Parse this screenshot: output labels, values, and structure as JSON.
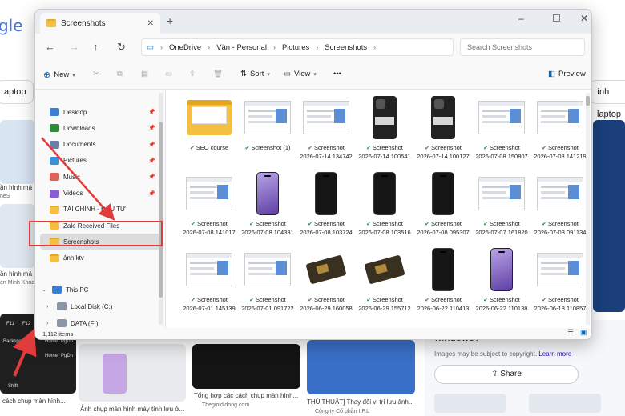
{
  "background": {
    "logo": "gle",
    "chips": [
      "aptop",
      "ính laptop"
    ],
    "left_snippets": [
      "ần hình má",
      "neS",
      "ần hình má",
      "en Minh Khoa"
    ],
    "captions": [
      {
        "text": "cách chụp màn hình...",
        "src": ""
      },
      {
        "text": "Ảnh chụp màn hình máy tính lưu ở...",
        "src": ""
      },
      {
        "text": "Tổng hợp các cách chụp màn hình...",
        "src": "Thegioididong.com"
      },
      {
        "text": "THỦ THUẬT] Thay đổi vị trí lưu ảnh...",
        "src": "Công ty Cổ phần I.P.L"
      }
    ],
    "panel_heading": "windows?",
    "panel_note": "Images may be subject to copyright.",
    "panel_learn": "Learn more",
    "share_label": "Share",
    "keys": [
      "F11",
      "F12",
      "Home",
      "PgUp",
      "Backspace",
      "Home",
      "PgDn",
      "Shift"
    ]
  },
  "window": {
    "tab_title": "Screenshots",
    "new_tab": "+",
    "controls": {
      "minimize": "–",
      "maximize": "☐",
      "close": "✕"
    },
    "breadcrumb": [
      "OneDrive",
      "Vân - Personal",
      "Pictures",
      "Screenshots"
    ],
    "search_placeholder": "Search Screenshots",
    "toolbar": {
      "new": "New",
      "sort": "Sort",
      "view": "View",
      "more": "•••",
      "preview": "Preview"
    }
  },
  "sidebar": {
    "quick_access": [
      {
        "label": "Desktop",
        "icon": "desktop-icon",
        "pinned": true
      },
      {
        "label": "Downloads",
        "icon": "download-icon",
        "pinned": true
      },
      {
        "label": "Documents",
        "icon": "document-icon",
        "pinned": true
      },
      {
        "label": "Pictures",
        "icon": "pictures-icon",
        "pinned": true
      },
      {
        "label": "Music",
        "icon": "music-icon",
        "pinned": true
      },
      {
        "label": "Videos",
        "icon": "video-icon",
        "pinned": true
      },
      {
        "label": "TÀI CHÍNH - ĐẦU TƯ",
        "icon": "folder-icon",
        "pinned": false
      },
      {
        "label": "Zalo Received Files",
        "icon": "folder-icon",
        "pinned": false
      },
      {
        "label": "Screenshots",
        "icon": "folder-icon",
        "pinned": false,
        "selected": true
      },
      {
        "label": "ảnh ktv",
        "icon": "folder-icon",
        "pinned": false
      }
    ],
    "this_pc": "This PC",
    "drives": [
      {
        "label": "Local Disk (C:)",
        "icon": "drive-icon"
      },
      {
        "label": "DATA (F:)",
        "icon": "drive-icon"
      }
    ]
  },
  "files": [
    {
      "line1": "SEO course",
      "line2": "",
      "kind": "folder"
    },
    {
      "line1": "Screenshot (1)",
      "line2": "",
      "kind": "shot"
    },
    {
      "line1": "Screenshot",
      "line2": "2026-07-14 134742",
      "kind": "shot"
    },
    {
      "line1": "Screenshot",
      "line2": "2026-07-14 100541",
      "kind": "case"
    },
    {
      "line1": "Screenshot",
      "line2": "2026-07-14 100127",
      "kind": "case"
    },
    {
      "line1": "Screenshot",
      "line2": "2026-07-08 150807",
      "kind": "shot"
    },
    {
      "line1": "Screenshot",
      "line2": "2026-07-08 141219",
      "kind": "shot"
    },
    {
      "line1": "Screenshot",
      "line2": "2026-07-08 141017",
      "kind": "shot"
    },
    {
      "line1": "Screenshot",
      "line2": "2026-07-08 104331",
      "kind": "phone-purple"
    },
    {
      "line1": "Screenshot",
      "line2": "2026-07-08 103724",
      "kind": "phone"
    },
    {
      "line1": "Screenshot",
      "line2": "2026-07-08 103516",
      "kind": "phone"
    },
    {
      "line1": "Screenshot",
      "line2": "2026-07-08 095307",
      "kind": "phone"
    },
    {
      "line1": "Screenshot",
      "line2": "2026-07-07 161820",
      "kind": "shot"
    },
    {
      "line1": "Screenshot",
      "line2": "2026-07-03 091134",
      "kind": "shot"
    },
    {
      "line1": "Screenshot",
      "line2": "2026-07-01 145139",
      "kind": "shot"
    },
    {
      "line1": "Screenshot",
      "line2": "2026-07-01 091722",
      "kind": "shot"
    },
    {
      "line1": "Screenshot",
      "line2": "2026-06-29 160058",
      "kind": "board"
    },
    {
      "line1": "Screenshot",
      "line2": "2026-06-29 155712",
      "kind": "board"
    },
    {
      "line1": "Screenshot",
      "line2": "2026-06-22 110413",
      "kind": "phone"
    },
    {
      "line1": "Screenshot",
      "line2": "2026-06-22 110138",
      "kind": "phone-purple"
    },
    {
      "line1": "Screenshot",
      "line2": "2026-06-18 110857",
      "kind": "shot"
    }
  ],
  "status": {
    "count": "1,112 items"
  },
  "colors": {
    "accent": "#0067c0",
    "annotation": "#e23b3b",
    "folder": "#f4c042",
    "check": "#2e8a3a"
  }
}
